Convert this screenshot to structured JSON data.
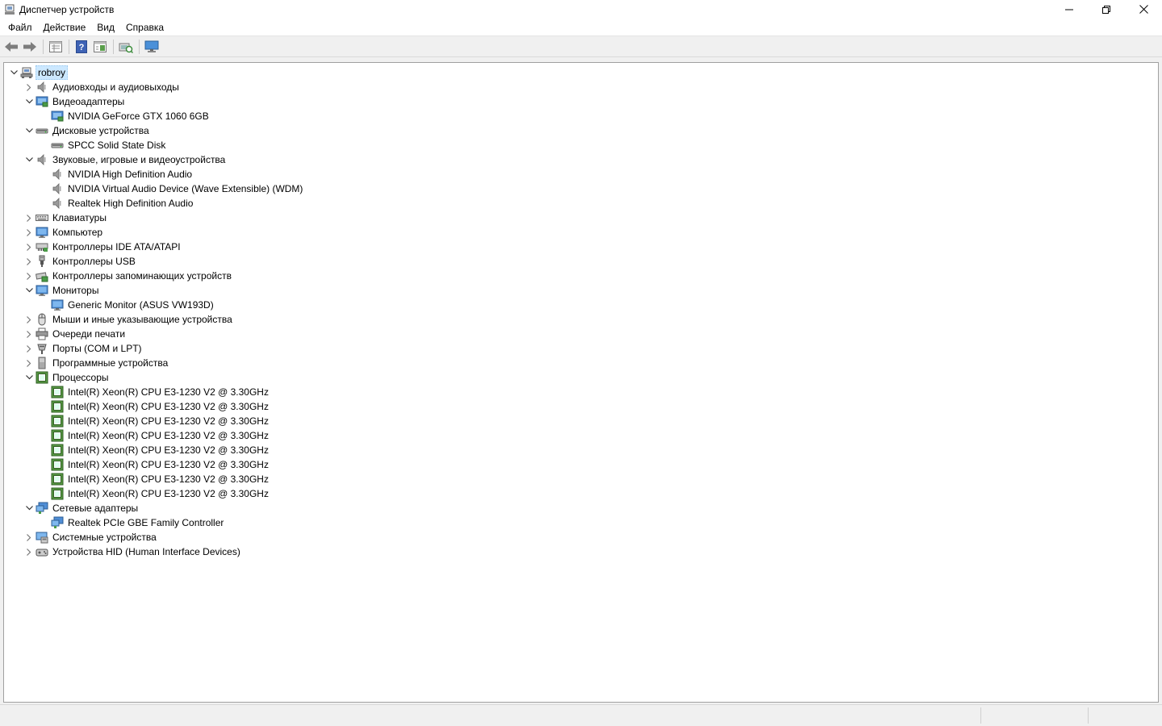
{
  "window": {
    "title": "Диспетчер устройств"
  },
  "menu": [
    "Файл",
    "Действие",
    "Вид",
    "Справка"
  ],
  "tree": {
    "root": "robroy",
    "items": [
      {
        "level": 1,
        "label": "Аудиовходы и аудиовыходы",
        "expanded": false,
        "icon": "audio"
      },
      {
        "level": 1,
        "label": "Видеоадаптеры",
        "expanded": true,
        "icon": "display"
      },
      {
        "level": 2,
        "label": "NVIDIA GeForce GTX 1060 6GB",
        "icon": "display"
      },
      {
        "level": 1,
        "label": "Дисковые устройства",
        "expanded": true,
        "icon": "disk"
      },
      {
        "level": 2,
        "label": "SPCC Solid State Disk",
        "icon": "disk"
      },
      {
        "level": 1,
        "label": "Звуковые, игровые и видеоустройства",
        "expanded": true,
        "icon": "audio"
      },
      {
        "level": 2,
        "label": "NVIDIA High Definition Audio",
        "icon": "audio"
      },
      {
        "level": 2,
        "label": "NVIDIA Virtual Audio Device (Wave Extensible) (WDM)",
        "icon": "audio"
      },
      {
        "level": 2,
        "label": "Realtek High Definition Audio",
        "icon": "audio"
      },
      {
        "level": 1,
        "label": "Клавиатуры",
        "expanded": false,
        "icon": "keyboard"
      },
      {
        "level": 1,
        "label": "Компьютер",
        "expanded": false,
        "icon": "monitor"
      },
      {
        "level": 1,
        "label": "Контроллеры IDE ATA/ATAPI",
        "expanded": false,
        "icon": "ide"
      },
      {
        "level": 1,
        "label": "Контроллеры USB",
        "expanded": false,
        "icon": "usb"
      },
      {
        "level": 1,
        "label": "Контроллеры запоминающих устройств",
        "expanded": false,
        "icon": "storage"
      },
      {
        "level": 1,
        "label": "Мониторы",
        "expanded": true,
        "icon": "monitor"
      },
      {
        "level": 2,
        "label": "Generic Monitor (ASUS VW193D)",
        "icon": "monitor"
      },
      {
        "level": 1,
        "label": "Мыши и иные указывающие устройства",
        "expanded": false,
        "icon": "mouse"
      },
      {
        "level": 1,
        "label": "Очереди печати",
        "expanded": false,
        "icon": "printer"
      },
      {
        "level": 1,
        "label": "Порты (COM и LPT)",
        "expanded": false,
        "icon": "port"
      },
      {
        "level": 1,
        "label": "Программные устройства",
        "expanded": false,
        "icon": "software"
      },
      {
        "level": 1,
        "label": "Процессоры",
        "expanded": true,
        "icon": "cpu"
      },
      {
        "level": 2,
        "label": "Intel(R) Xeon(R) CPU E3-1230 V2 @ 3.30GHz",
        "icon": "cpu"
      },
      {
        "level": 2,
        "label": "Intel(R) Xeon(R) CPU E3-1230 V2 @ 3.30GHz",
        "icon": "cpu"
      },
      {
        "level": 2,
        "label": "Intel(R) Xeon(R) CPU E3-1230 V2 @ 3.30GHz",
        "icon": "cpu"
      },
      {
        "level": 2,
        "label": "Intel(R) Xeon(R) CPU E3-1230 V2 @ 3.30GHz",
        "icon": "cpu"
      },
      {
        "level": 2,
        "label": "Intel(R) Xeon(R) CPU E3-1230 V2 @ 3.30GHz",
        "icon": "cpu"
      },
      {
        "level": 2,
        "label": "Intel(R) Xeon(R) CPU E3-1230 V2 @ 3.30GHz",
        "icon": "cpu"
      },
      {
        "level": 2,
        "label": "Intel(R) Xeon(R) CPU E3-1230 V2 @ 3.30GHz",
        "icon": "cpu"
      },
      {
        "level": 2,
        "label": "Intel(R) Xeon(R) CPU E3-1230 V2 @ 3.30GHz",
        "icon": "cpu"
      },
      {
        "level": 1,
        "label": "Сетевые адаптеры",
        "expanded": true,
        "icon": "network"
      },
      {
        "level": 2,
        "label": "Realtek PCIe GBE Family Controller",
        "icon": "network"
      },
      {
        "level": 1,
        "label": "Системные устройства",
        "expanded": false,
        "icon": "system"
      },
      {
        "level": 1,
        "label": "Устройства HID (Human Interface Devices)",
        "expanded": false,
        "icon": "hid"
      }
    ]
  },
  "icons": {
    "app": "device-manager-icon",
    "minimize": "minimize-icon",
    "maximize": "restore-icon",
    "close": "close-icon",
    "toolbar": [
      "back-arrow-icon",
      "forward-arrow-icon",
      "properties-icon",
      "help-icon",
      "view-icon",
      "scan-hardware-icon",
      "monitor-icon"
    ]
  },
  "colors": {
    "selection": "#cce8ff",
    "accent": "#0078d7"
  }
}
